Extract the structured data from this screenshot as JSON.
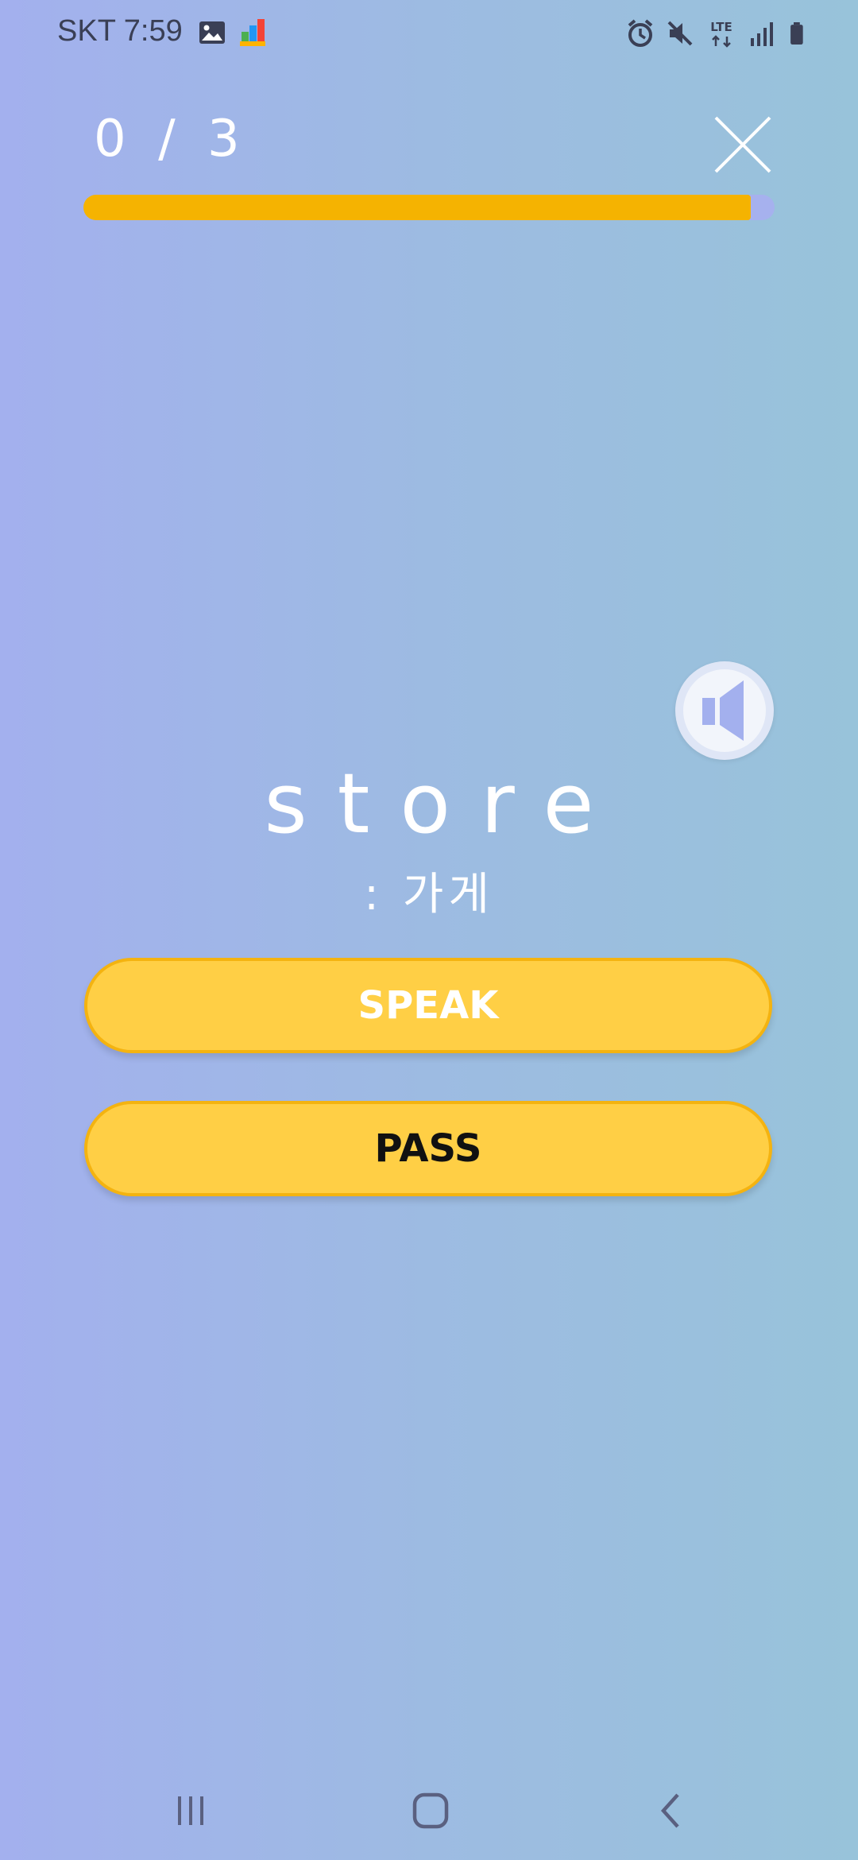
{
  "status_bar": {
    "carrier_time": "SKT 7:59",
    "network_label": "LTE"
  },
  "quiz": {
    "progress_text": "0 / 3",
    "progress_fill_fraction": 0.965,
    "word": "store",
    "meaning": ": 가게"
  },
  "buttons": {
    "speak_label": "SPEAK",
    "pass_label": "PASS"
  },
  "colors": {
    "accent_yellow": "#ffcf45",
    "progress_yellow": "#f5b301",
    "track_lavender": "#a6b1ee",
    "speaker_blue": "#a3b0ee"
  },
  "icons": {
    "close": "close-icon",
    "speaker": "speaker-icon",
    "nav_recents": "recents-icon",
    "nav_home": "home-icon",
    "nav_back": "back-icon"
  }
}
